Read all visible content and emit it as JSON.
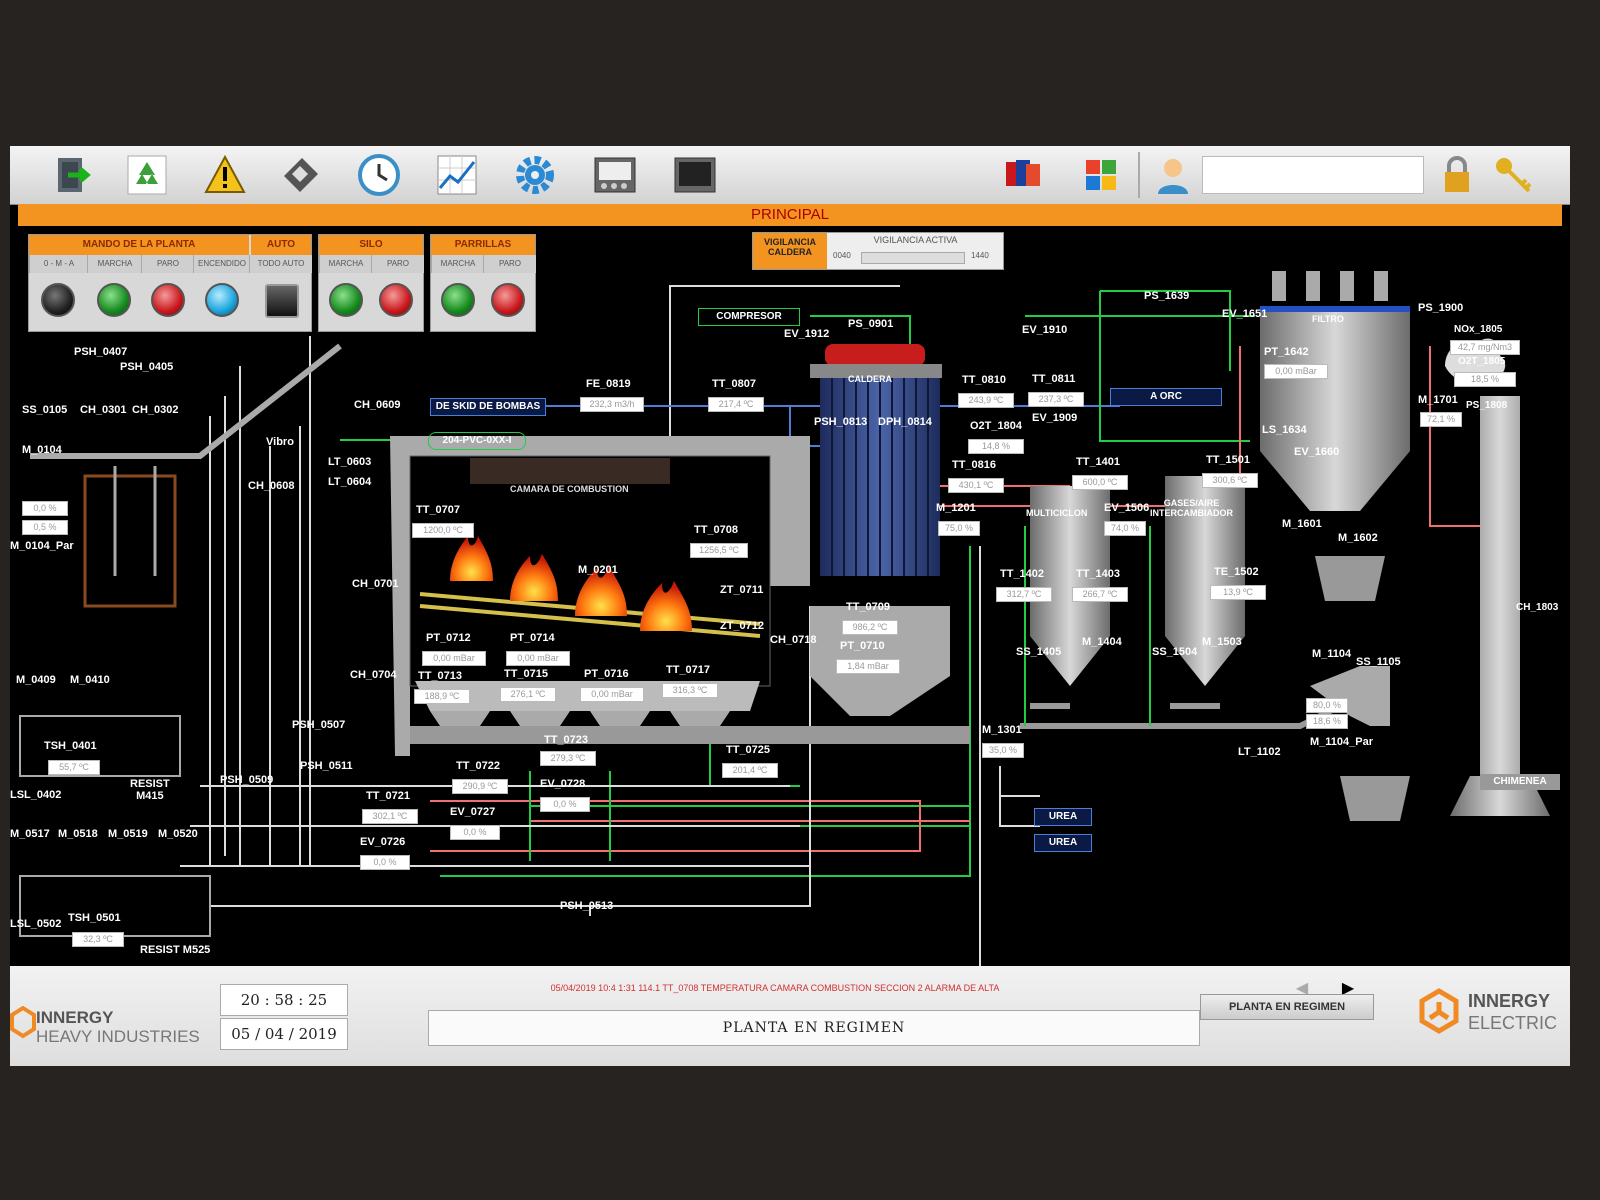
{
  "title": "PRINCIPAL",
  "toolbar": {
    "icons": [
      "exit-icon",
      "recycle-icon",
      "warning-icon",
      "save-disk-icon",
      "clock-icon",
      "trend-chart-icon",
      "gear-icon",
      "alarm-panel-icon",
      "monitor-icon",
      "flags-icon",
      "windows-icon",
      "user-icon",
      "lock-icon",
      "key-icon"
    ]
  },
  "mando": {
    "title": "MANDO DE LA PLANTA",
    "auto": "AUTO",
    "sub": [
      "0 - M - A",
      "MARCHA",
      "PARO",
      "ENCENDIDO",
      "TODO AUTO"
    ]
  },
  "silo": {
    "title": "SILO",
    "sub": [
      "MARCHA",
      "PARO"
    ]
  },
  "parrillas": {
    "title": "PARRILLAS",
    "sub": [
      "MARCHA",
      "PARO"
    ]
  },
  "vigilancia": {
    "title": "VIGILANCIA CALDERA",
    "status": "VIGILANCIA ACTIVA",
    "min": "0040",
    "max": "1440"
  },
  "labels": {
    "psh_0407": "PSH_0407",
    "psh_0405": "PSH_0405",
    "ss_0105": "SS_0105",
    "ch_0301": "CH_0301",
    "ch_0302": "CH_0302",
    "m_0104": "M_0104",
    "m_0104_par": "M_0104_Par",
    "ch_0609": "CH_0609",
    "vibro": "Vibro",
    "lt_0603": "LT_0603",
    "lt_0604": "LT_0604",
    "ch_0608": "CH_0608",
    "ch_0701": "CH_0701",
    "ch_0704": "CH_0704",
    "m_0409": "M_0409",
    "m_0410": "M_0410",
    "tsh_0401": "TSH_0401",
    "lsl_0402": "LSL_0402",
    "resist_m415": "RESIST\nM415",
    "psh_0507": "PSH_0507",
    "psh_0509": "PSH_0509",
    "psh_0511": "PSH_0511",
    "m_0517": "M_0517",
    "m_0518": "M_0518",
    "m_0519": "M_0519",
    "m_0520": "M_0520",
    "lsl_0502": "LSL_0502",
    "tsh_0501": "TSH_0501",
    "resist_m525": "RESIST M525",
    "psh_0513": "PSH_0513",
    "de_skid": "DE SKID DE BOMBAS",
    "pvc": "204-PVC-0XX-I",
    "fe_0819": "FE_0819",
    "tt_0807": "TT_0807",
    "compresor": "COMPRESOR",
    "ev_1912": "EV_1912",
    "ps_0901": "PS_0901",
    "caldera": "CALDERA",
    "psh_0813": "PSH_0813",
    "dph_0814": "DPH_0814",
    "camara": "CAMARA DE COMBUSTION",
    "tt_0707": "TT_0707",
    "tt_0708": "TT_0708",
    "m_0201": "M_0201",
    "zt_0711": "ZT_0711",
    "zt_0712": "ZT_0712",
    "ch_0718": "CH_0718",
    "pt_0712": "PT_0712",
    "pt_0714": "PT_0714",
    "tt_0713": "TT_0713",
    "tt_0715": "TT_0715",
    "pt_0716": "PT_0716",
    "tt_0717": "TT_0717",
    "tt_0709": "TT_0709",
    "pt_0710": "PT_0710",
    "tt_0723": "TT_0723",
    "tt_0722": "TT_0722",
    "tt_0721": "TT_0721",
    "ev_0728": "EV_0728",
    "ev_0727": "EV_0727",
    "ev_0726": "EV_0726",
    "tt_0725": "TT_0725",
    "tt_0810": "TT_0810",
    "tt_0811": "TT_0811",
    "a_orc": "A ORC",
    "o2t_1804": "O2T_1804",
    "ev_1909": "EV_1909",
    "tt_0816": "TT_0816",
    "m_1201": "M_1201",
    "tt_1401": "TT_1401",
    "multiciclon": "MULTICICLON",
    "ev_1506": "EV_1506",
    "gases": "GASES/AIRE\nINTERCAMBIADOR",
    "tt_1501": "TT_1501",
    "tt_1402": "TT_1402",
    "tt_1403": "TT_1403",
    "tt_1502": "TE_1502",
    "ss_1405": "SS_1405",
    "m_1404": "M_1404",
    "ss_1504": "SS_1504",
    "m_1503": "M_1503",
    "m_1301": "M_1301",
    "urea1": "UREA",
    "urea2": "UREA",
    "ev_1910": "EV_1910",
    "ps_1639": "PS_1639",
    "ev_1651": "EV_1651",
    "filtro": "FILTRO",
    "pt_1642": "PT_1642",
    "ls_1634": "LS_1634",
    "ev_1660": "EV_1660",
    "m_1601": "M_1601",
    "m_1602": "M_1602",
    "ps_1900": "PS_1900",
    "nox_1805": "NOx_1805",
    "o2t_1805": "O2T_1805",
    "ps_1808": "PS_1808",
    "m_1701": "M_1701",
    "ch_1803": "CH_1803",
    "chimenea": "CHIMENEA",
    "m_1104": "M_1104",
    "ss_1105": "SS_1105",
    "m_1104_par": "M_1104_Par",
    "lt_1102": "LT_1102"
  },
  "values": {
    "m_0104_a": "0,0 %",
    "m_0104_b": "0,5 %",
    "tsh_0401": "55,7 ºC",
    "tsh_0501": "32,3 ºC",
    "fe_0819": "232,3 m3/h",
    "tt_0807": "217,4 ºC",
    "tt_0707": "1200,0 ºC",
    "tt_0708": "1256,5 ºC",
    "pt_0712": "0,00 mBar",
    "pt_0714": "0,00 mBar",
    "tt_0713": "188,9 ºC",
    "tt_0715": "276,1 ºC",
    "pt_0716": "0,00 mBar",
    "tt_0717": "316,3 ºC",
    "tt_0709": "986,2 ºC",
    "pt_0710": "1,84 mBar",
    "tt_0723": "279,3 ºC",
    "tt_0722": "290,9 ºC",
    "tt_0721": "302,1 ºC",
    "ev_0728": "0,0 %",
    "ev_0727": "0,0 %",
    "ev_0726": "0,0 %",
    "tt_0725": "201,4 ºC",
    "tt_0810": "243,9 ºC",
    "tt_0811": "237,3 ºC",
    "o2t_1804": "14,8 %",
    "tt_0816": "430,1 ºC",
    "m_1201": "75,0 %",
    "tt_1401": "600,0 ºC",
    "ev_1506": "74,0 %",
    "tt_1501": "300,6 ºC",
    "tt_1402": "312,7 ºC",
    "tt_1403": "266,7 ºC",
    "tt_1502": "13,9 ºC",
    "m_1301": "35,0 %",
    "pt_1642": "0,00 mBar",
    "nox_1805": "42,7 mg/Nm3",
    "o2t_1805": "18,5 %",
    "m_1701": "72,1 %",
    "m_1104_a": "80,0 %",
    "m_1104_b": "18,6 %"
  },
  "status": {
    "brand_left_1": "INNERGY",
    "brand_left_2": "HEAVY INDUSTRIES",
    "time": "20 : 58 : 25",
    "date": "05 / 04 / 2019",
    "alarm": "05/04/2019 10:4 1:31 114.1   TT_0708   TEMPERATURA CAMARA COMBUSTION SECCION 2   ALARMA DE ALTA",
    "state": "PLANTA EN REGIMEN",
    "mode_button": "PLANTA EN REGIMEN",
    "brand_right_1": "INNERGY",
    "brand_right_2": "ELECTRIC"
  }
}
